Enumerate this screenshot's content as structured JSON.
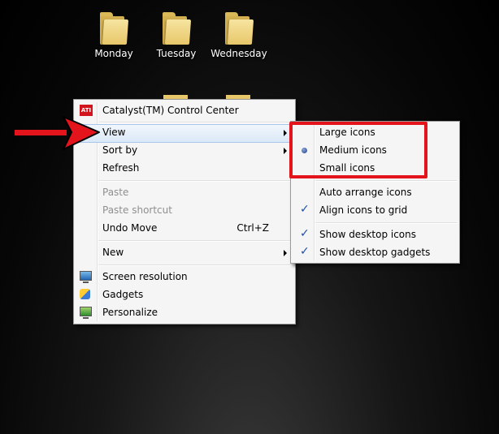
{
  "desktop": {
    "icons": [
      {
        "label": "Monday"
      },
      {
        "label": "Tuesday"
      },
      {
        "label": "Wednesday"
      }
    ]
  },
  "context_menu": {
    "items": [
      {
        "label": "Catalyst(TM) Control Center",
        "icon": "ati-icon"
      },
      {
        "label": "View",
        "submenu": true,
        "highlighted": true
      },
      {
        "label": "Sort by",
        "submenu": true
      },
      {
        "label": "Refresh"
      },
      {
        "label": "Paste",
        "disabled": true
      },
      {
        "label": "Paste shortcut",
        "disabled": true
      },
      {
        "label": "Undo Move",
        "shortcut": "Ctrl+Z"
      },
      {
        "label": "New",
        "submenu": true
      },
      {
        "label": "Screen resolution",
        "icon": "monitor-icon"
      },
      {
        "label": "Gadgets",
        "icon": "gadgets-icon"
      },
      {
        "label": "Personalize",
        "icon": "personalize-icon"
      }
    ]
  },
  "view_submenu": {
    "items": [
      {
        "label": "Large icons"
      },
      {
        "label": "Medium icons",
        "selected": true
      },
      {
        "label": "Small icons"
      },
      {
        "label": "Auto arrange icons",
        "checked": false
      },
      {
        "label": "Align icons to grid",
        "checked": true
      },
      {
        "label": "Show desktop icons",
        "checked": true
      },
      {
        "label": "Show desktop gadgets",
        "checked": true
      }
    ]
  },
  "annotations": {
    "arrow_color": "#e3141b",
    "highlight_box_color": "#e3141b"
  },
  "colors": {
    "menu_background": "#f5f5f5",
    "highlight": "#dbe8f7",
    "check": "#1f4fa6"
  }
}
